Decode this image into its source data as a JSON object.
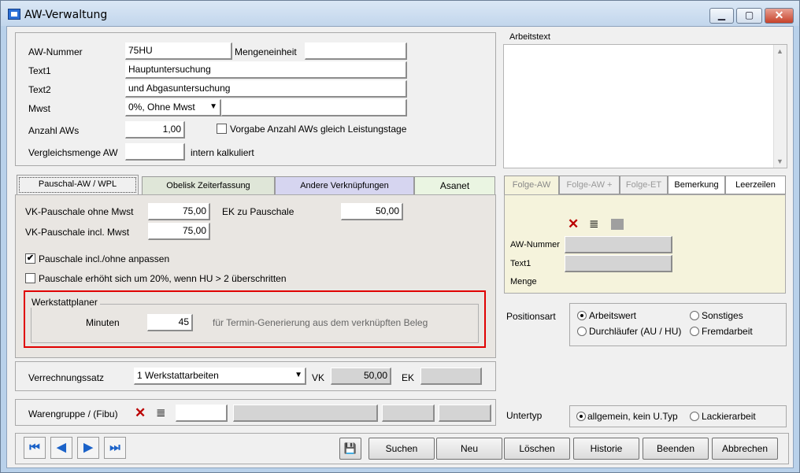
{
  "window": {
    "title": "AW-Verwaltung",
    "min": "▁",
    "max": "▢",
    "close": "✕"
  },
  "stammdaten": {
    "aw_nummer_label": "AW-Nummer",
    "aw_nummer": "75HU",
    "mengeneinheit_label": "Mengeneinheit",
    "mengeneinheit": "",
    "text1_label": "Text1",
    "text1": "Hauptuntersuchung",
    "text2_label": "Text2",
    "text2": "und Abgasuntersuchung",
    "mwst_label": "Mwst",
    "mwst": "0%, Ohne Mwst",
    "anzahl_label": "Anzahl AWs",
    "anzahl": "1,00",
    "vorgabe_label": "Vorgabe Anzahl AWs gleich Leistungstage",
    "vergleich_label": "Vergleichsmenge AW",
    "vergleich": "",
    "intern_label": "intern kalkuliert"
  },
  "arbeitstext": {
    "label": "Arbeitstext",
    "value": ""
  },
  "tabs": [
    "Pauschal-AW / WPL",
    "Obelisk Zeiterfassung",
    "Andere Verknüpfungen",
    "Asanet"
  ],
  "pauschal": {
    "vk_ohne_label": "VK-Pauschale ohne Mwst",
    "vk_ohne": "75,00",
    "ek_label": "EK zu Pauschale",
    "ek": "50,00",
    "vk_incl_label": "VK-Pauschale incl. Mwst",
    "vk_incl": "75,00",
    "anpassen_label": "Pauschale incl./ohne anpassen",
    "anpassen": "✔",
    "erhoeht_label": "Pauschale erhöht sich um 20%, wenn HU > 2 überschritten"
  },
  "werkstattplaner": {
    "label": "Werkstattplaner",
    "minuten_label": "Minuten",
    "minuten": "45",
    "hint": "für Termin-Generierung aus dem verknüpften Beleg"
  },
  "folge_tabs": [
    "Folge-AW",
    "Folge-AW +",
    "Folge-ET",
    "Bemerkung",
    "Leerzeilen"
  ],
  "folge": {
    "aw_label": "AW-Nummer",
    "aw": "",
    "text1_label": "Text1",
    "text1": "",
    "menge_label": "Menge"
  },
  "positionsart": {
    "label": "Positionsart",
    "opts": [
      "Arbeitswert",
      "Sonstiges",
      "Durchläufer (AU / HU)",
      "Fremdarbeit"
    ]
  },
  "verrechnung": {
    "label": "Verrechnungssatz",
    "value": "1 Werkstattarbeiten",
    "vk_label": "VK",
    "vk": "50,00",
    "ek_label": "EK",
    "ek": ""
  },
  "warengruppe": {
    "label": "Warengruppe / (Fibu)"
  },
  "untertyp": {
    "label": "Untertyp",
    "opts": [
      "allgemein, kein U.Typ",
      "Lackierarbeit"
    ]
  },
  "buttons": {
    "suchen": "Suchen",
    "neu": "Neu",
    "loeschen": "Löschen",
    "historie": "Historie",
    "beenden": "Beenden",
    "abbrechen": "Abbrechen"
  },
  "icons": {
    "first": "⏮",
    "prev": "◀",
    "next": "▶",
    "last": "⏭",
    "x": "✕",
    "list": "≣",
    "down": "▼",
    "up": "▲",
    "save": "💾"
  },
  "colors": {
    "highlight": "#e00000",
    "obelisk": "#dfe6d8",
    "andere": "#d6d5f0",
    "asanet": "#eaf5e2",
    "folge_panel": "#f5f3dc"
  }
}
